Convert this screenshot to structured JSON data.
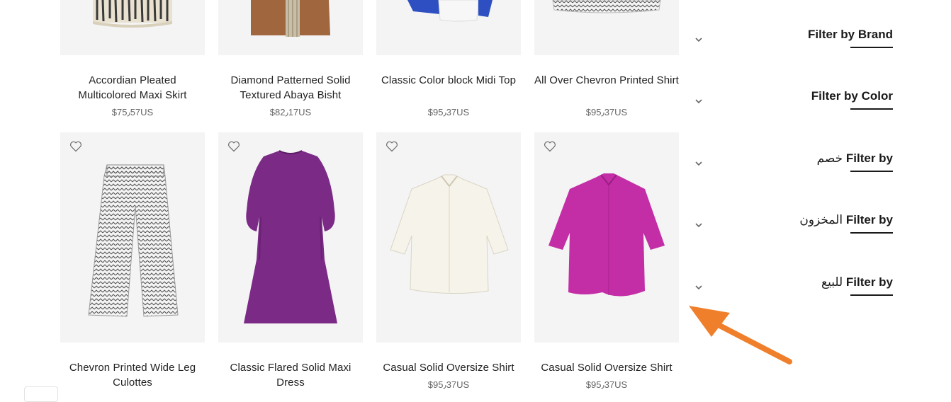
{
  "products_row1": [
    {
      "name": "Accordian Pleated Multicolored Maxi Skirt",
      "price": "$75٫57US"
    },
    {
      "name": "Diamond Patterned Solid Textured Abaya Bisht",
      "price": "$82٫17US"
    },
    {
      "name": "Classic Color block Midi Top",
      "price": "$95٫37US"
    },
    {
      "name": "All Over Chevron Printed Shirt",
      "price": "$95٫37US"
    }
  ],
  "products_row2": [
    {
      "name": "Chevron Printed Wide Leg Culottes",
      "price": ""
    },
    {
      "name": "Classic Flared Solid Maxi Dress",
      "price": ""
    },
    {
      "name": "Casual Solid Oversize Shirt",
      "price": "$95٫37US"
    },
    {
      "name": "Casual Solid Oversize Shirt",
      "price": "$95٫37US"
    }
  ],
  "filters": [
    {
      "prefix": "Filter by",
      "suffix": "Brand",
      "icon": "chevron-down-icon"
    },
    {
      "prefix": "Filter by",
      "suffix": "Color",
      "icon": "chevron-down-icon"
    },
    {
      "prefix": "Filter by",
      "suffix": "خصم",
      "icon": "chevron-down-icon"
    },
    {
      "prefix": "Filter by",
      "suffix": "المخزون",
      "icon": "chevron-down-icon"
    },
    {
      "prefix": "Filter by",
      "suffix": "للبيع",
      "icon": "chevron-down-icon"
    }
  ],
  "colors": {
    "arrow": "#f07f2b",
    "dress": "#7b2a86",
    "shirt_pink": "#c32ea7",
    "card_bg": "#f4f4f4"
  }
}
